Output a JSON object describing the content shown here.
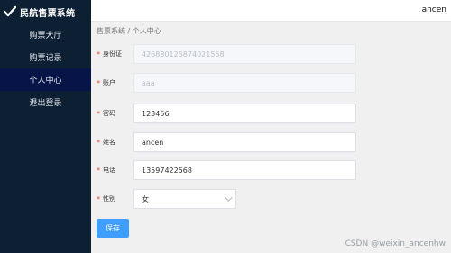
{
  "app": {
    "title": "民航售票系统"
  },
  "sidebar": {
    "items": [
      {
        "label": "购票大厅"
      },
      {
        "label": "购票记录"
      },
      {
        "label": "个人中心"
      },
      {
        "label": "退出登录"
      }
    ],
    "active_index": 2
  },
  "header": {
    "username": "ancen"
  },
  "breadcrumb": {
    "root": "售票系统",
    "separator": "/",
    "current": "个人中心"
  },
  "form": {
    "fields": [
      {
        "label": "身份证",
        "value": "426880125874021558",
        "disabled": true
      },
      {
        "label": "账户",
        "value": "aaa",
        "disabled": true
      },
      {
        "label": "密码",
        "value": "123456",
        "disabled": false
      },
      {
        "label": "姓名",
        "value": "ancen",
        "disabled": false
      },
      {
        "label": "电话",
        "value": "13597422568",
        "disabled": false
      },
      {
        "label": "性别",
        "value": "女",
        "disabled": false
      }
    ],
    "required_mark": "*",
    "save_label": "保存"
  },
  "watermark": "CSDN @weixin_ancenhw",
  "colors": {
    "sidebar_bg": "#0c1f33",
    "active_bg": "#071447",
    "primary": "#409eff",
    "required": "#e0403a"
  }
}
